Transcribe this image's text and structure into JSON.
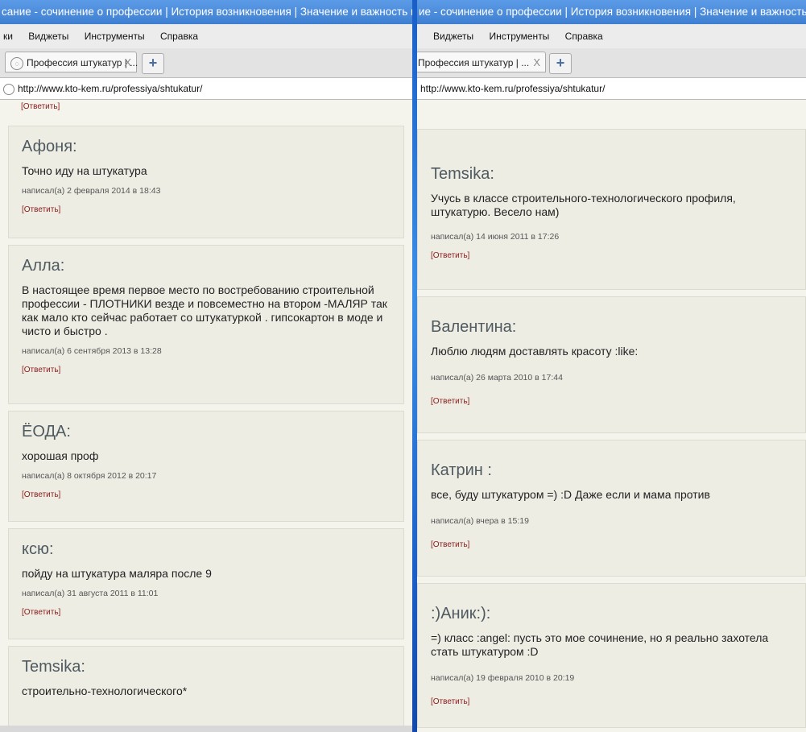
{
  "left": {
    "title": "сание - сочинение о профессии | История возникновения | Значение и важность выбора проф",
    "menu": [
      "ки",
      "Виджеты",
      "Инструменты",
      "Справка"
    ],
    "tab_label": "Профессия штукатур | ...",
    "tab_close": "X",
    "new_tab": "+",
    "url": "http://www.kto-kem.ru/professiya/shtukatur/",
    "top_reply": "[Ответить]",
    "comments": [
      {
        "author": "Афоня:",
        "text": "Точно иду на штукатура",
        "meta": "написал(а) 2 февраля 2014 в 18:43",
        "reply": "[Ответить]"
      },
      {
        "author": "Алла:",
        "text": "В настоящее время первое место по востребованию строительной профессии - ПЛОТНИКИ везде и повсеместно на втором -МАЛЯР так как мало кто сейчас работает со штукатуркой . гипсокартон в моде и чисто и быстро .",
        "meta": "написал(а) 6 сентября 2013 в 13:28",
        "reply": "[Ответить]"
      },
      {
        "author": "ЁОДА:",
        "text": "хорошая проф",
        "meta": "написал(а) 8 октября 2012 в 20:17",
        "reply": "[Ответить]"
      },
      {
        "author": "ксю:",
        "text": "пойду на штукатура маляра после 9",
        "meta": "написал(а) 31 августа 2011 в 11:01",
        "reply": "[Ответить]"
      },
      {
        "author": "Temsika:",
        "text": "строительно-технологического*",
        "meta": "",
        "reply": ""
      }
    ]
  },
  "right": {
    "title": "ие - сочинение о профессии | История возникновения | Значение и важность выбора про",
    "menu": [
      "Виджеты",
      "Инструменты",
      "Справка"
    ],
    "tab_label": "Профессия штукатур | ...",
    "tab_close": "X",
    "new_tab": "+",
    "url": "http://www.kto-kem.ru/professiya/shtukatur/",
    "comments": [
      {
        "author": "Temsika:",
        "text": "Учусь в классе строительного-технологического профиля, штукатурю. Весело нам)",
        "meta": "написал(а) 14 июня 2011 в 17:26",
        "reply": "[Ответить]"
      },
      {
        "author": "Валентина:",
        "text": "Люблю людям доставлять красоту :like:",
        "meta": "написал(а) 26 марта 2010 в 17:44",
        "reply": "[Ответить]"
      },
      {
        "author": "Катрин :",
        "text": "все, буду штукатуром =) :D Даже если и мама против",
        "meta": "написал(а) вчера в 15:19",
        "reply": "[Ответить]"
      },
      {
        "author": ":)Аник:):",
        "text": "=) класс :angel: пусть это мое сочинение, но я реально захотела стать штукатуром :D",
        "meta": "написал(а) 19 февраля 2010 в 20:19",
        "reply": "[Ответить]"
      }
    ]
  }
}
